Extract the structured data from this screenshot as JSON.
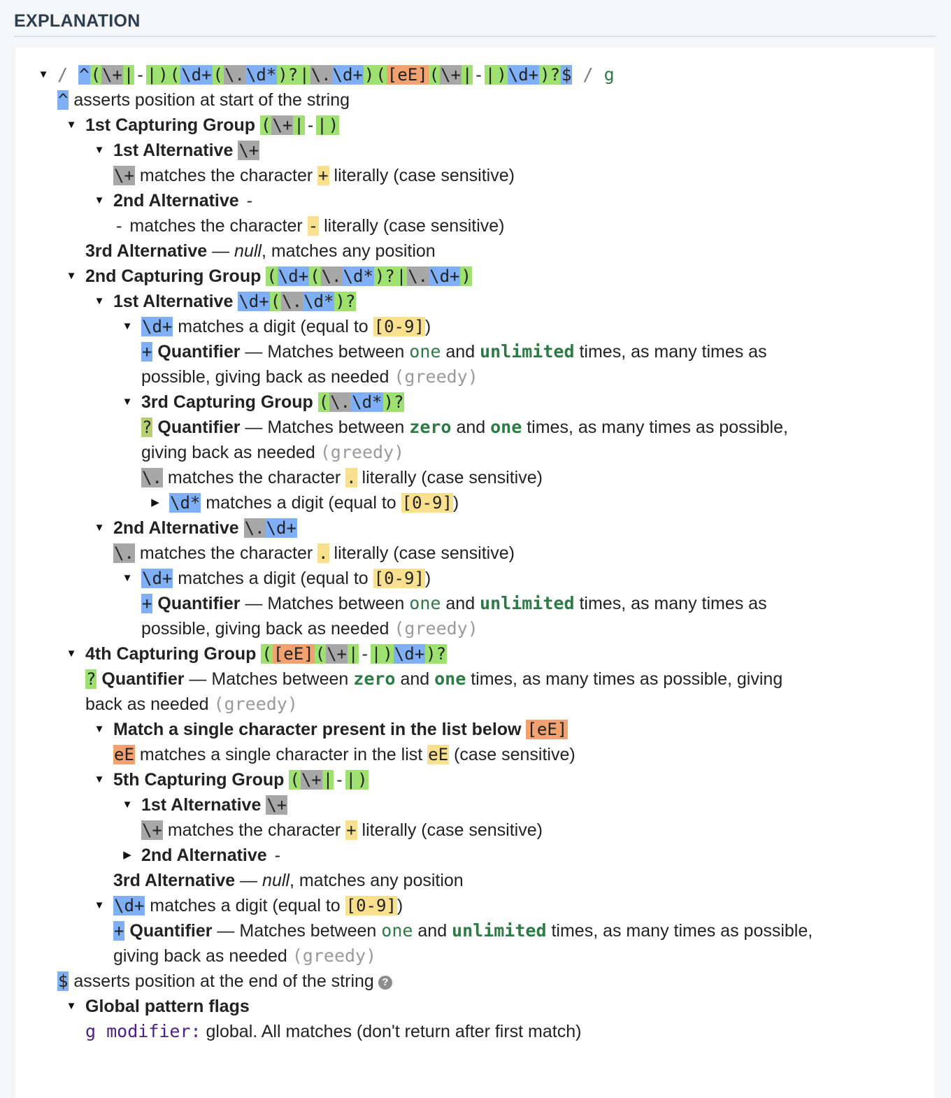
{
  "header": {
    "title": "EXPLANATION"
  },
  "regex": {
    "open_slash": "/",
    "tokens": [
      {
        "t": "^",
        "c": "bl"
      },
      {
        "t": "(",
        "c": "gr"
      },
      {
        "t": "\\+",
        "c": "gy"
      },
      {
        "t": "|",
        "c": "gr"
      },
      {
        "t": "-",
        "c": ""
      },
      {
        "t": "|",
        "c": "gr"
      },
      {
        "t": ")",
        "c": "gr"
      },
      {
        "t": "(",
        "c": "gr"
      },
      {
        "t": "\\d+",
        "c": "bl"
      },
      {
        "t": "(",
        "c": "gr"
      },
      {
        "t": "\\.",
        "c": "gy"
      },
      {
        "t": "\\d*",
        "c": "bl"
      },
      {
        "t": ")?",
        "c": "gr"
      },
      {
        "t": "|",
        "c": "gr"
      },
      {
        "t": "\\.",
        "c": "gy"
      },
      {
        "t": "\\d+",
        "c": "bl"
      },
      {
        "t": ")",
        "c": "gr"
      },
      {
        "t": "(",
        "c": "gr"
      },
      {
        "t": "[eE]",
        "c": "og"
      },
      {
        "t": "(",
        "c": "gr"
      },
      {
        "t": "\\+",
        "c": "gy"
      },
      {
        "t": "|",
        "c": "gr"
      },
      {
        "t": "-",
        "c": ""
      },
      {
        "t": "|",
        "c": "gr"
      },
      {
        "t": ")",
        "c": "gr"
      },
      {
        "t": "\\d+",
        "c": "bl"
      },
      {
        "t": ")?",
        "c": "gr"
      },
      {
        "t": "$",
        "c": "bl"
      }
    ],
    "close_slash": "/",
    "flags": "g"
  },
  "lines": {
    "start": {
      "tok": "^",
      "text": " asserts position at start of the string"
    },
    "g1": {
      "title": "1st Capturing Group",
      "tok": "(\\+|-|)"
    },
    "g1_alt1": {
      "title": "1st Alternative",
      "tok": "\\+"
    },
    "g1_alt1_desc": {
      "tok": "\\+",
      "pre": " matches the character ",
      "lit": "+",
      "post": " literally (case sensitive)"
    },
    "g1_alt2": {
      "title": "2nd Alternative",
      "tok": "-"
    },
    "g1_alt2_desc": {
      "tok": "-",
      "pre": " matches the character ",
      "lit": "-",
      "post": " literally (case sensitive)"
    },
    "g1_alt3": {
      "title": "3rd Alternative",
      "dash": " — ",
      "null": "null",
      "post": ", matches any position"
    },
    "g2": {
      "title": "2nd Capturing Group",
      "tok": "(\\d+(\\.\\d*)?|\\.\\d+)"
    },
    "g2_alt1": {
      "title": "1st Alternative",
      "tok": "\\d+(\\.\\d*)?"
    },
    "g2_alt1_digit": {
      "tok": "\\d+",
      "pre": " matches a digit (equal to ",
      "cls": "[0-9]",
      "post": ")"
    },
    "g2_alt1_quant": {
      "tok": "+",
      "title": "Quantifier",
      "pre": " — Matches between ",
      "a": "one",
      "mid": " and ",
      "b": "unlimited",
      "post": " times, as many times as",
      "line2": "possible, giving back as needed ",
      "greedy": "(greedy)"
    },
    "g3": {
      "title": "3rd Capturing Group",
      "tok": "(\\.\\d*)?"
    },
    "g3_quant": {
      "tok": "?",
      "title": "Quantifier",
      "pre": " — Matches between ",
      "a": "zero",
      "mid": " and ",
      "b": "one",
      "post": " times, as many times as possible,",
      "line2": "giving back as needed ",
      "greedy": "(greedy)"
    },
    "g3_dot": {
      "tok": "\\.",
      "pre": " matches the character ",
      "lit": ".",
      "post": " literally (case sensitive)"
    },
    "g3_digit": {
      "tok": "\\d*",
      "pre": " matches a digit (equal to ",
      "cls": "[0-9]",
      "post": ")"
    },
    "g2_alt2": {
      "title": "2nd Alternative",
      "tok": "\\.\\d+"
    },
    "g2_alt2_dot": {
      "tok": "\\.",
      "pre": " matches the character ",
      "lit": ".",
      "post": " literally (case sensitive)"
    },
    "g2_alt2_digit": {
      "tok": "\\d+",
      "pre": " matches a digit (equal to ",
      "cls": "[0-9]",
      "post": ")"
    },
    "g2_alt2_quant": {
      "tok": "+",
      "title": "Quantifier",
      "pre": " — Matches between ",
      "a": "one",
      "mid": " and ",
      "b": "unlimited",
      "post": " times, as many times as",
      "line2": "possible, giving back as needed ",
      "greedy": "(greedy)"
    },
    "g4": {
      "title": "4th Capturing Group",
      "tok": "([eE](\\+|-|)\\d+)?"
    },
    "g4_quant": {
      "tok": "?",
      "title": "Quantifier",
      "pre": " — Matches between ",
      "a": "zero",
      "mid": " and ",
      "b": "one",
      "post": " times, as many times as possible, giving",
      "line2": "back as needed ",
      "greedy": "(greedy)"
    },
    "g4_set": {
      "title": "Match a single character present in the list below",
      "tok": "[eE]"
    },
    "g4_set_desc": {
      "tok": "eE",
      "pre": " matches a single character in the list ",
      "lit": "eE",
      "post": " (case sensitive)"
    },
    "g5": {
      "title": "5th Capturing Group",
      "tok": "(\\+|-|)"
    },
    "g5_alt1": {
      "title": "1st Alternative",
      "tok": "\\+"
    },
    "g5_alt1_desc": {
      "tok": "\\+",
      "pre": " matches the character ",
      "lit": "+",
      "post": " literally (case sensitive)"
    },
    "g5_alt2": {
      "title": "2nd Alternative",
      "tok": "-"
    },
    "g5_alt3": {
      "title": "3rd Alternative",
      "dash": " — ",
      "null": "null",
      "post": ", matches any position"
    },
    "g4_digit": {
      "tok": "\\d+",
      "pre": " matches a digit (equal to ",
      "cls": "[0-9]",
      "post": ")"
    },
    "g4_digit_quant": {
      "tok": "+",
      "title": "Quantifier",
      "pre": " — Matches between ",
      "a": "one",
      "mid": " and ",
      "b": "unlimited",
      "post": " times, as many times as possible,",
      "line2": "giving back as needed ",
      "greedy": "(greedy)"
    },
    "end": {
      "tok": "$",
      "text": " asserts position at the end of the string",
      "help": "?"
    },
    "flags_title": "Global pattern flags",
    "flag_g": {
      "name": "g modifier:",
      "text": " global. All matches (don't return after first match)"
    }
  }
}
